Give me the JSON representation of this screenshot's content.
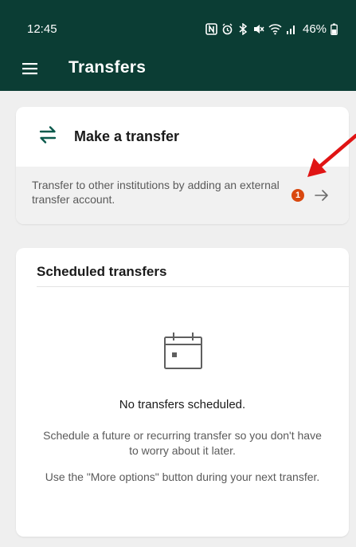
{
  "status_bar": {
    "time": "12:45",
    "battery_percent": "46%",
    "icons": [
      "nfc-icon",
      "alarm-icon",
      "bluetooth-icon",
      "mute-icon",
      "wifi-icon",
      "signal-icon",
      "battery-icon"
    ]
  },
  "toolbar": {
    "title": "Transfers",
    "menu_icon": "hamburger-menu-icon"
  },
  "transfer_card": {
    "title": "Make a transfer",
    "icon": "transfer-arrows-icon",
    "description": "Transfer to other institutions by adding an external transfer account.",
    "badge_count": "1",
    "action_icon": "arrow-right-icon"
  },
  "scheduled_card": {
    "title": "Scheduled transfers",
    "icon": "calendar-icon",
    "empty_title": "No transfers scheduled.",
    "empty_description": "Schedule a future or recurring transfer so you don't have to worry about it later.",
    "empty_hint": "Use the \"More options\" button during your next transfer."
  },
  "colors": {
    "app_bar": "#0b3d34",
    "accent": "#0b5a4c",
    "badge": "#d9480f",
    "annotation": "#e01414",
    "background": "#efefef"
  }
}
